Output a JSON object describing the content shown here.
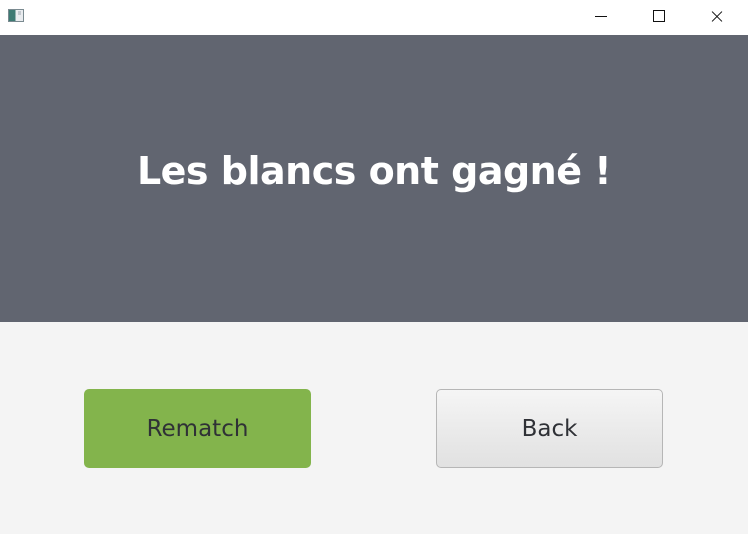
{
  "window": {
    "controls": [
      "minimize-icon",
      "maximize-icon",
      "close-icon"
    ]
  },
  "banner": {
    "message": "Les blancs ont gagné !"
  },
  "actions": {
    "rematch_label": "Rematch",
    "back_label": "Back"
  },
  "colors": {
    "banner": "#616570",
    "rematch_button": "#83b44c",
    "page_background": "#f4f4f4",
    "back_button": "#e8e8e8"
  }
}
